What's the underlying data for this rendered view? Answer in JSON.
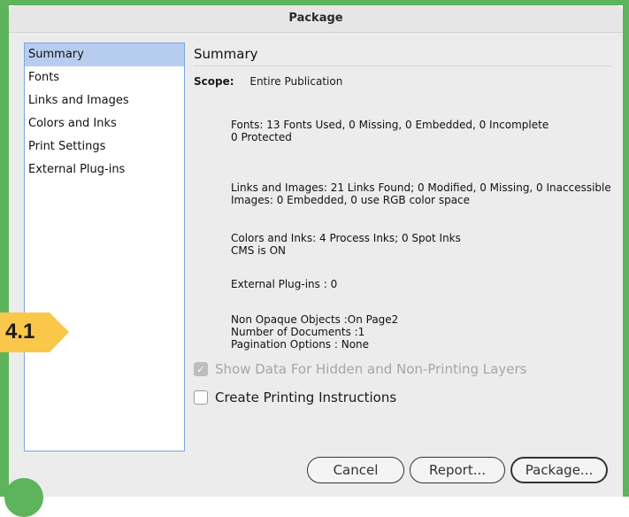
{
  "window": {
    "title": "Package"
  },
  "sidebar": {
    "items": [
      {
        "label": "Summary",
        "selected": true
      },
      {
        "label": "Fonts"
      },
      {
        "label": "Links and Images"
      },
      {
        "label": "Colors and Inks"
      },
      {
        "label": "Print Settings"
      },
      {
        "label": "External Plug-ins"
      }
    ]
  },
  "summary": {
    "title": "Summary",
    "scope_label": "Scope:",
    "scope_value": "Entire Publication",
    "fonts_line1": "Fonts: 13 Fonts Used, 0 Missing, 0 Embedded, 0 Incomplete",
    "fonts_line2": "0 Protected",
    "links_line1": "Links and Images: 21 Links Found; 0 Modified, 0 Missing, 0 Inaccessible",
    "links_line2": "Images: 0 Embedded, 0 use RGB color space",
    "colors_line1": "Colors and Inks: 4 Process Inks; 0 Spot Inks",
    "colors_line2": "CMS is ON",
    "plugins_line": "External Plug-ins : 0",
    "misc_line1": "Non Opaque Objects :On Page2",
    "misc_line2": "Number of Documents :1",
    "misc_line3": "Pagination Options : None"
  },
  "options": {
    "show_hidden_label": "Show Data For Hidden and Non-Printing Layers",
    "show_hidden_checked": true,
    "show_hidden_disabled": true,
    "create_instructions_label": "Create Printing Instructions",
    "create_instructions_checked": false
  },
  "buttons": {
    "cancel": "Cancel",
    "report": "Report...",
    "package": "Package..."
  },
  "overlay": {
    "step_badge": "4.1"
  },
  "colors": {
    "frame": "#5db45a",
    "badge": "#f9c74a",
    "selection": "#b7cdef"
  }
}
